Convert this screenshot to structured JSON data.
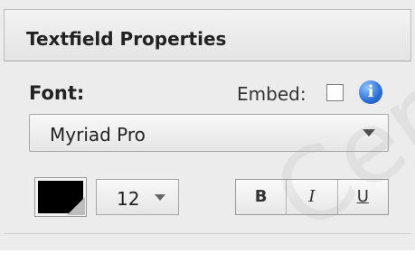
{
  "panel": {
    "title": "Textfield Properties"
  },
  "font": {
    "label": "Font:",
    "embed_label": "Embed:",
    "embed_checked": false,
    "selected_font": "Myriad Pro",
    "info_icon": "info-icon",
    "info_glyph": "i"
  },
  "format": {
    "color_swatch_color": "#000000",
    "size_value": "12",
    "bold_label": "B",
    "italic_label": "I",
    "underline_label": "U"
  },
  "watermark": "Cer"
}
